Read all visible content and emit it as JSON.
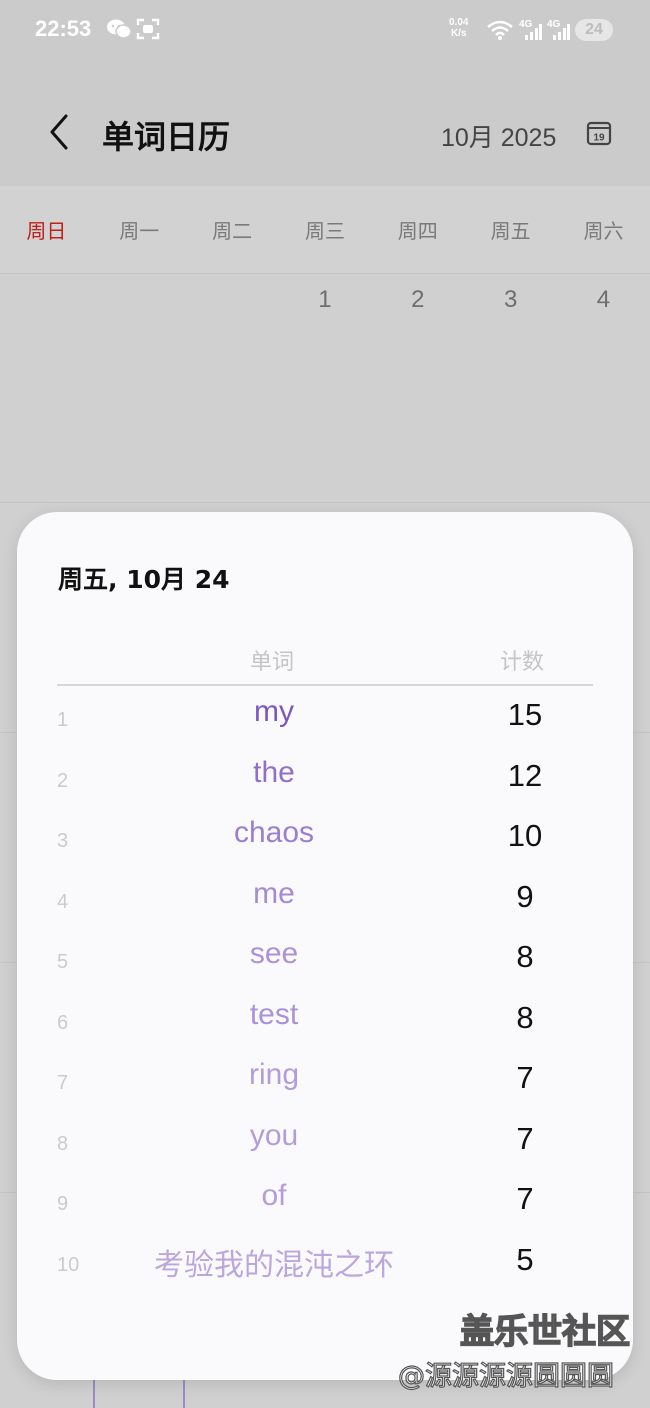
{
  "status_bar": {
    "time": "22:53",
    "net_speed_value": "0.04",
    "net_speed_unit": "K/s",
    "signal_1": "4G",
    "signal_2": "4G",
    "battery": "24"
  },
  "header": {
    "title": "单词日历",
    "month": "10月 2025",
    "calendar_icon_day": "19"
  },
  "weekdays": [
    "周日",
    "周一",
    "周二",
    "周三",
    "周四",
    "周五",
    "周六"
  ],
  "calendar": {
    "first_week_days": [
      "",
      "",
      "",
      "1",
      "2",
      "3",
      "4"
    ]
  },
  "modal": {
    "date_title": "周五, 10月 24",
    "col_word": "单词",
    "col_count": "计数",
    "rows": [
      {
        "rank": "1",
        "word": "my",
        "count": "15",
        "color": "#7b58bf"
      },
      {
        "rank": "2",
        "word": "the",
        "count": "12",
        "color": "#8f6fc9"
      },
      {
        "rank": "3",
        "word": "chaos",
        "count": "10",
        "color": "#9b7ed0"
      },
      {
        "rank": "4",
        "word": "me",
        "count": "9",
        "color": "#a68bd4"
      },
      {
        "rank": "5",
        "word": "see",
        "count": "8",
        "color": "#ab91d6"
      },
      {
        "rank": "6",
        "word": "test",
        "count": "8",
        "color": "#ab91d6"
      },
      {
        "rank": "7",
        "word": "ring",
        "count": "7",
        "color": "#b39cd9"
      },
      {
        "rank": "8",
        "word": "you",
        "count": "7",
        "color": "#b39cd9"
      },
      {
        "rank": "9",
        "word": "of",
        "count": "7",
        "color": "#b39cd9"
      },
      {
        "rank": "10",
        "word": "考验我的混沌之环",
        "count": "5",
        "color": "#bba7dd"
      }
    ]
  },
  "watermark": {
    "main": "盖乐世社区",
    "sub": "@源源源源圆圆圆"
  }
}
